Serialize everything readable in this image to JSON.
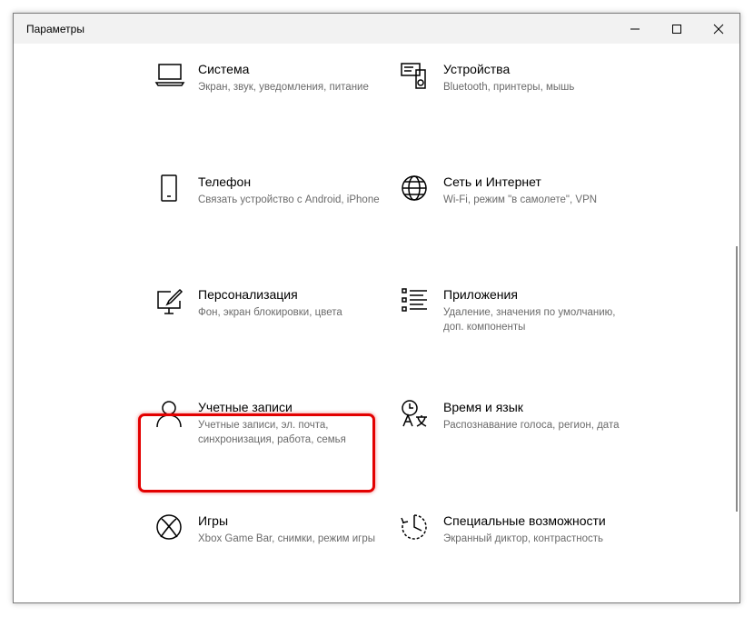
{
  "window": {
    "title": "Параметры"
  },
  "tiles": [
    {
      "name": "Система",
      "desc": "Экран, звук, уведомления, питание",
      "icon": "laptop-icon"
    },
    {
      "name": "Устройства",
      "desc": "Bluetooth, принтеры, мышь",
      "icon": "devices-icon"
    },
    {
      "name": "Телефон",
      "desc": "Связать устройство с Android, iPhone",
      "icon": "phone-icon"
    },
    {
      "name": "Сеть и Интернет",
      "desc": "Wi-Fi, режим \"в самолете\", VPN",
      "icon": "globe-icon"
    },
    {
      "name": "Персонализация",
      "desc": "Фон, экран блокировки, цвета",
      "icon": "personalization-icon"
    },
    {
      "name": "Приложения",
      "desc": "Удаление, значения по умолчанию, доп. компоненты",
      "icon": "apps-list-icon"
    },
    {
      "name": "Учетные записи",
      "desc": "Учетные записи, эл. почта, синхронизация, работа, семья",
      "icon": "person-icon"
    },
    {
      "name": "Время и язык",
      "desc": "Распознавание голоса, регион, дата",
      "icon": "time-language-icon"
    },
    {
      "name": "Игры",
      "desc": "Xbox Game Bar, снимки, режим игры",
      "icon": "xbox-icon"
    },
    {
      "name": "Специальные возможности",
      "desc": "Экранный диктор, контрастность",
      "icon": "accessibility-icon"
    }
  ],
  "colors": {
    "highlight": "#e30000",
    "desc_text": "#6b6b6b"
  }
}
